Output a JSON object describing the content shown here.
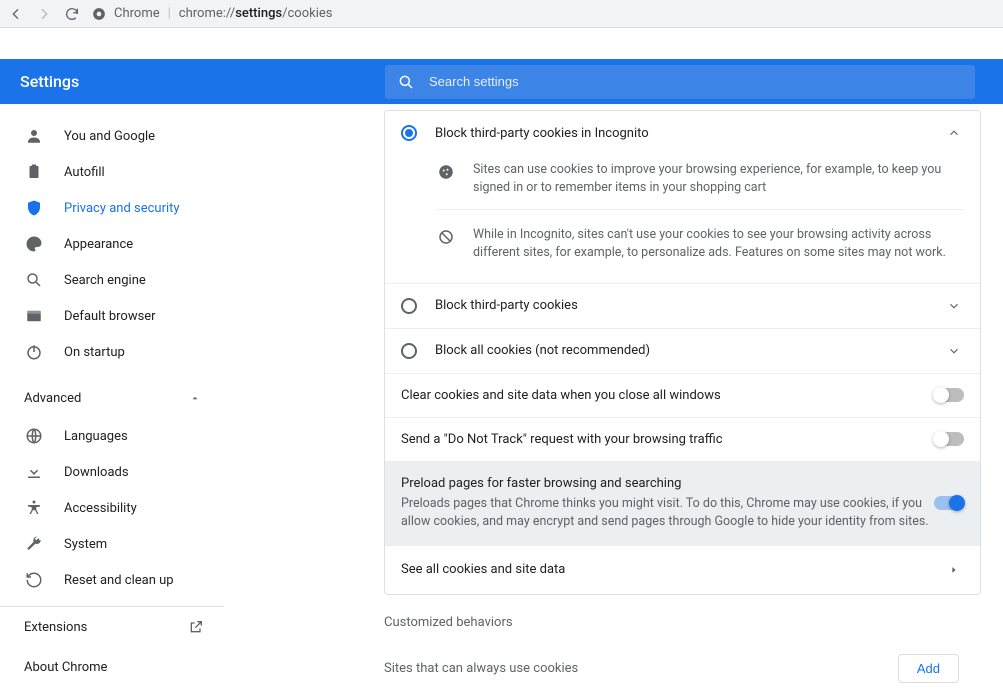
{
  "toolbar": {
    "site_label": "Chrome",
    "url_prefix": "chrome://",
    "url_bold": "settings",
    "url_suffix": "/cookies"
  },
  "header": {
    "title": "Settings",
    "search_placeholder": "Search settings"
  },
  "sidebar": {
    "items": [
      {
        "label": "You and Google"
      },
      {
        "label": "Autofill"
      },
      {
        "label": "Privacy and security"
      },
      {
        "label": "Appearance"
      },
      {
        "label": "Search engine"
      },
      {
        "label": "Default browser"
      },
      {
        "label": "On startup"
      }
    ],
    "advanced_label": "Advanced",
    "adv_items": [
      {
        "label": "Languages"
      },
      {
        "label": "Downloads"
      },
      {
        "label": "Accessibility"
      },
      {
        "label": "System"
      },
      {
        "label": "Reset and clean up"
      }
    ],
    "extensions": "Extensions",
    "about": "About Chrome"
  },
  "cookies": {
    "opt_incognito": "Block third-party cookies in Incognito",
    "desc_cookie": "Sites can use cookies to improve your browsing experience, for example, to keep you signed in or to remember items in your shopping cart",
    "desc_block": "While in Incognito, sites can't use your cookies to see your browsing activity across different sites, for example, to personalize ads. Features on some sites may not work.",
    "opt_third": "Block third-party cookies",
    "opt_all": "Block all cookies (not recommended)",
    "clear_label": "Clear cookies and site data when you close all windows",
    "dnt_label": "Send a \"Do Not Track\" request with your browsing traffic",
    "preload_title": "Preload pages for faster browsing and searching",
    "preload_sub": "Preloads pages that Chrome thinks you might visit. To do this, Chrome may use cookies, if you allow cookies, and may encrypt and send pages through Google to hide your identity from sites.",
    "see_all": "See all cookies and site data",
    "custom_header": "Customized behaviors",
    "allow_header": "Sites that can always use cookies",
    "add_btn": "Add"
  }
}
